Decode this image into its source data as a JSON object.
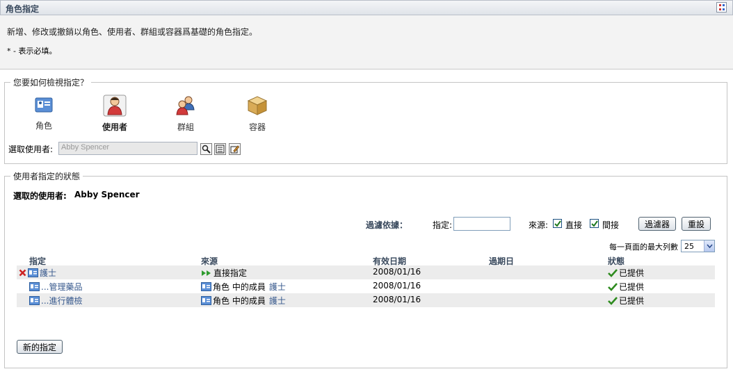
{
  "header": {
    "title": "角色指定"
  },
  "description": {
    "text": "新增、修改或撤銷以角色、使用者、群組或容器爲基礎的角色指定。",
    "required_note": "* - 表示必填。"
  },
  "view_section": {
    "legend": "您要如何檢視指定？",
    "options": [
      {
        "label": "角色",
        "icon": "role-card-icon",
        "selected": false
      },
      {
        "label": "使用者",
        "icon": "user-icon",
        "selected": true
      },
      {
        "label": "群組",
        "icon": "group-icon",
        "selected": false
      },
      {
        "label": "容器",
        "icon": "container-box-icon",
        "selected": false
      }
    ],
    "select_user_label": "選取使用者:",
    "select_user_value": "Abby Spencer"
  },
  "status_section": {
    "legend": "使用者指定的狀態",
    "selected_user_label": "選取的使用者:",
    "selected_user_name": "Abby Spencer",
    "filter": {
      "title": "過濾依據：",
      "assignment_label": "指定:",
      "assignment_value": "",
      "source_label": "來源:",
      "direct_label": "直接",
      "direct_checked": true,
      "indirect_label": "間接",
      "indirect_checked": true,
      "filter_button": "過濾器",
      "reset_button": "重設"
    },
    "rows_per_page_label": "每一頁面的最大列數",
    "rows_per_page_value": "25",
    "columns": [
      "指定",
      "來源",
      "有效日期",
      "過期日",
      "狀態"
    ],
    "rows": [
      {
        "removable": true,
        "assignment": "護士",
        "source_text": "直接指定",
        "source_type": "direct",
        "source_link": "",
        "effective_date": "2008/01/16",
        "expiry_date": "",
        "status": "已提供"
      },
      {
        "removable": false,
        "assignment": "...管理藥品",
        "source_text": "角色 中的成員",
        "source_type": "member",
        "source_link": "護士",
        "effective_date": "2008/01/16",
        "expiry_date": "",
        "status": "已提供"
      },
      {
        "removable": false,
        "assignment": "...進行體檢",
        "source_text": "角色 中的成員",
        "source_type": "member",
        "source_link": "護士",
        "effective_date": "2008/01/16",
        "expiry_date": "",
        "status": "已提供"
      }
    ],
    "new_assignment_button": "新的指定"
  },
  "colors": {
    "title_text": "#3a4a5e",
    "link": "#37598d",
    "status_check": "#2e8b1f",
    "remove_x": "#cc2222",
    "direct_arrow": "#2e9b2e"
  }
}
